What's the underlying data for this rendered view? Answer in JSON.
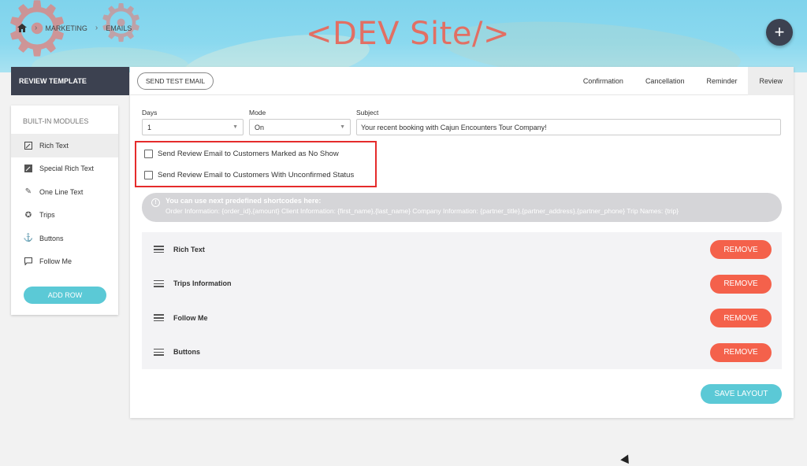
{
  "header": {
    "breadcrumb": [
      "MARKETING",
      "EMAILS"
    ],
    "site_title": "<DEV Site/>",
    "fab_label": "+"
  },
  "sidebar": {
    "section_title": "REVIEW TEMPLATE",
    "modules_title": "BUILT-IN MODULES",
    "items": [
      {
        "label": "Rich Text",
        "icon": "rich-text-icon"
      },
      {
        "label": "Special Rich Text",
        "icon": "special-rich-text-icon"
      },
      {
        "label": "One Line Text",
        "icon": "pencil-icon"
      },
      {
        "label": "Trips",
        "icon": "badge-icon"
      },
      {
        "label": "Buttons",
        "icon": "anchor-icon"
      },
      {
        "label": "Follow Me",
        "icon": "chat-icon"
      }
    ],
    "add_row_label": "ADD ROW"
  },
  "toolbar": {
    "send_test_label": "SEND TEST EMAIL",
    "tabs": [
      "Confirmation",
      "Cancellation",
      "Reminder",
      "Review"
    ],
    "active_tab": "Review"
  },
  "form": {
    "days_label": "Days",
    "days_value": "1",
    "mode_label": "Mode",
    "mode_value": "On",
    "subject_label": "Subject",
    "subject_value": "Your recent booking with Cajun Encounters Tour Company!"
  },
  "checkboxes": [
    {
      "label": "Send Review Email to Customers Marked as No Show",
      "checked": false
    },
    {
      "label": "Send Review Email to Customers With Unconfirmed Status",
      "checked": false
    }
  ],
  "notice": {
    "title": "You can use next predefined shortcodes here:",
    "body": "Order Information: {order_id},{amount} Client Information: {first_name},{last_name} Company Information: {partner_title},{partner_address},{partner_phone} Trip Names: {trip}"
  },
  "layout_rows": [
    {
      "label": "Rich Text",
      "remove_label": "REMOVE"
    },
    {
      "label": "Trips Information",
      "remove_label": "REMOVE"
    },
    {
      "label": "Follow Me",
      "remove_label": "REMOVE"
    },
    {
      "label": "Buttons",
      "remove_label": "REMOVE"
    }
  ],
  "save_label": "SAVE LAYOUT",
  "colors": {
    "accent_teal": "#5bc9d6",
    "remove_red": "#f4614b",
    "dark_nav": "#3c4150",
    "highlight_red": "#e52b2b"
  }
}
